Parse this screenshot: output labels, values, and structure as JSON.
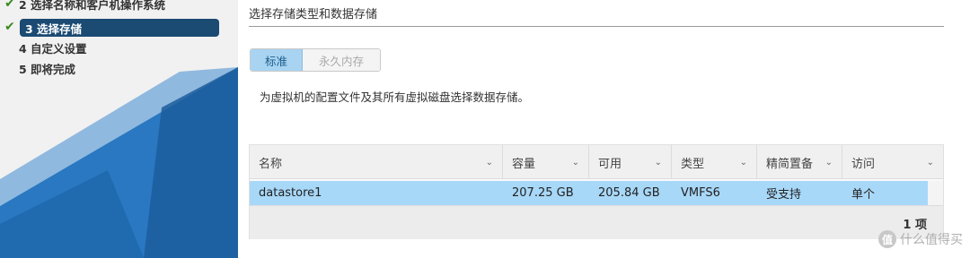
{
  "wizard": {
    "steps": [
      {
        "label": "2 选择名称和客户机操作系统",
        "done": true
      },
      {
        "label": "3 选择存储",
        "active": true,
        "done": true
      },
      {
        "label": "4 自定义设置"
      },
      {
        "label": "5 即将完成"
      }
    ],
    "check_glyph": "✔"
  },
  "main": {
    "section_title": "选择存储类型和数据存储",
    "tabs": [
      {
        "label": "标准",
        "selected": true
      },
      {
        "label": "永久内存",
        "selected": false
      }
    ],
    "description": "为虚拟机的配置文件及其所有虚拟磁盘选择数据存储。",
    "table": {
      "columns": [
        "名称",
        "容量",
        "可用",
        "类型",
        "精简置备",
        "访问"
      ],
      "rows": [
        [
          "datastore1",
          "207.25 GB",
          "205.84 GB",
          "VMFS6",
          "受支持",
          "单个"
        ]
      ],
      "footer_count": "1 项"
    }
  },
  "watermark": {
    "badge": "值",
    "text": "什么值得买"
  },
  "colors": {
    "nav_active_bg": "#1b4a73",
    "nav_blue": "#1f6fb8",
    "selected_row": "#a8d8f8",
    "tab_selected": "#a8d4f2",
    "check_green": "#3c8a1e"
  },
  "icons": [
    "check-icon",
    "chevron-down-icon"
  ]
}
